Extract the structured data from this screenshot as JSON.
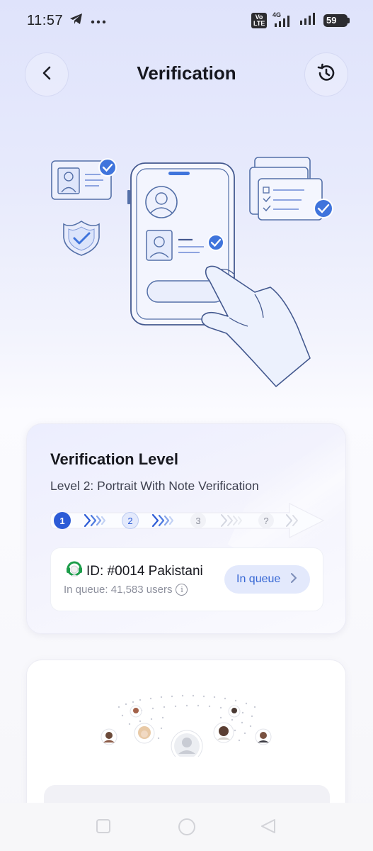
{
  "status_bar": {
    "time": "11:57",
    "network_label": "Vo LTE",
    "network_type": "4G",
    "battery": "59"
  },
  "header": {
    "title": "Verification",
    "back_icon": "chevron-left-icon",
    "history_icon": "history-icon"
  },
  "verification_level": {
    "title": "Verification Level",
    "subtitle": "Level 2: Portrait With Note Verification",
    "steps": [
      "1",
      "2",
      "3",
      "?"
    ],
    "current_step": 2,
    "queue": {
      "id_text": "ID: #0014 Pakistani",
      "count_text": "In queue: 41,583 users",
      "button_label": "In queue"
    }
  },
  "colors": {
    "accent": "#3566d4",
    "step_active": "#2c5bd6",
    "button_bg": "#e3e9fc"
  }
}
